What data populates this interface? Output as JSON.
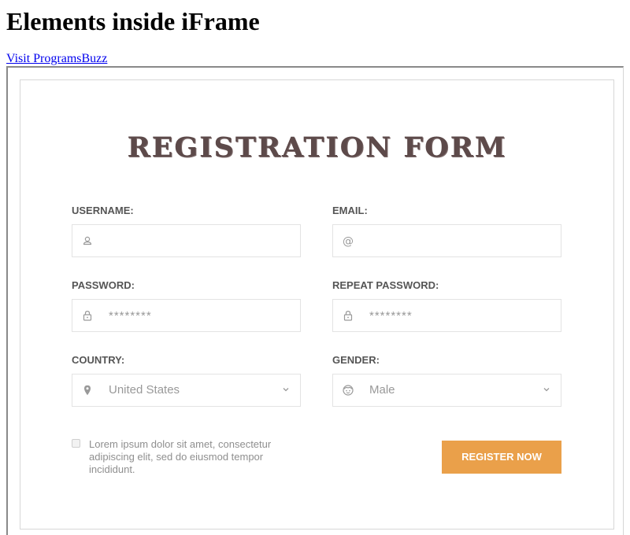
{
  "page": {
    "heading": "Elements inside iFrame",
    "link_text": "Visit ProgramsBuzz"
  },
  "form": {
    "title": "REGISTRATION FORM",
    "fields": {
      "username": {
        "label": "USERNAME:",
        "placeholder": "",
        "icon": "user-icon"
      },
      "email": {
        "label": "EMAIL:",
        "placeholder": "",
        "icon": "at-icon"
      },
      "password": {
        "label": "PASSWORD:",
        "placeholder": "********",
        "icon": "lock-icon"
      },
      "repeat_password": {
        "label": "REPEAT PASSWORD:",
        "placeholder": "********",
        "icon": "lock-icon"
      },
      "country": {
        "label": "COUNTRY:",
        "selected": "United States",
        "icon": "map-pin-icon"
      },
      "gender": {
        "label": "GENDER:",
        "selected": "Male",
        "icon": "face-icon"
      }
    },
    "terms_text": "Lorem ipsum dolor sit amet, consectetur adipiscing elit, sed do eiusmod tempor incididunt.",
    "terms_checked": false,
    "register_label": "REGISTER NOW"
  },
  "colors": {
    "title": "#5d4a4a",
    "button": "#eaa04a",
    "label": "#555555",
    "placeholder": "#999999",
    "link": "#0000ee"
  }
}
